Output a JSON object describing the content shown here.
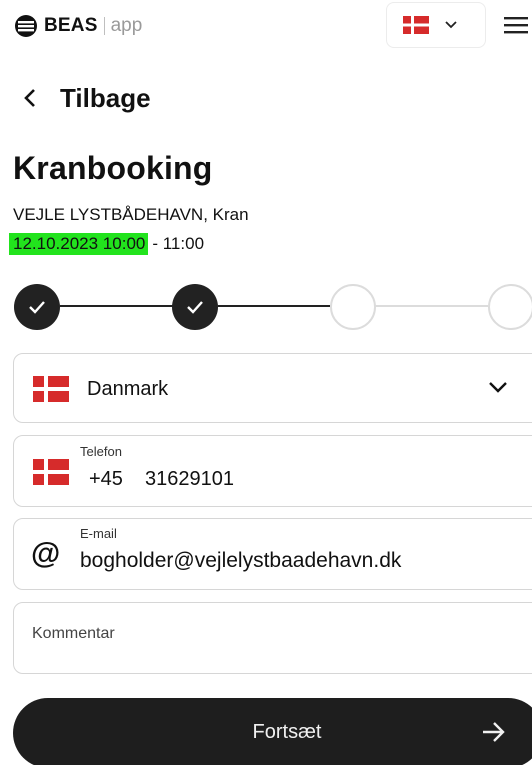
{
  "header": {
    "brand": "BEAS",
    "app_label": "app",
    "language_flag_icon": "denmark-flag-icon",
    "language_chevron_icon": "chevron-down-icon",
    "menu_icon": "hamburger-menu-icon"
  },
  "nav": {
    "back_label": "Tilbage",
    "back_icon": "chevron-left-icon"
  },
  "booking": {
    "title": "Kranbooking",
    "location": "VEJLE LYSTBÅDEHAVN, Kran",
    "start_time": "12.10.2023 10:00",
    "end_time": "- 11:00",
    "highlight_color": "#22e31d"
  },
  "stepper": {
    "steps": [
      {
        "state": "done"
      },
      {
        "state": "done"
      },
      {
        "state": "todo"
      },
      {
        "state": "todo"
      }
    ]
  },
  "form": {
    "country": {
      "value": "Danmark",
      "flag_icon": "denmark-flag-icon",
      "chevron_icon": "chevron-down-icon"
    },
    "phone": {
      "label": "Telefon",
      "code": "+45",
      "number": "31629101",
      "flag_icon": "denmark-flag-icon"
    },
    "email": {
      "label": "E-mail",
      "value": "bogholder@vejlelystbaadehavn.dk",
      "icon": "at-sign-icon"
    },
    "comment": {
      "placeholder": "Kommentar"
    }
  },
  "actions": {
    "continue_label": "Fortsæt",
    "continue_icon": "arrow-right-icon"
  },
  "colors": {
    "flag_red": "#d62b2b",
    "button_bg": "#1e1e1e",
    "step_done": "#222222"
  }
}
